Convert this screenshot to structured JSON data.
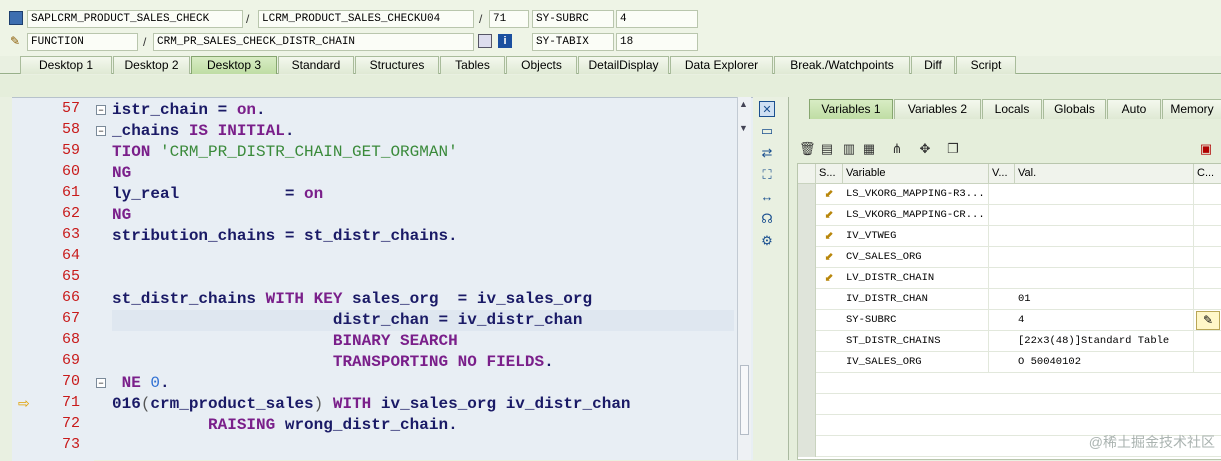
{
  "header": {
    "program": "SAPLCRM_PRODUCT_SALES_CHECK",
    "include": "LCRM_PRODUCT_SALES_CHECKU04",
    "line": "71",
    "subrc_label": "SY-SUBRC",
    "subrc_value": "4",
    "type": "FUNCTION",
    "event": "CRM_PR_SALES_CHECK_DISTR_CHAIN",
    "tabix_label": "SY-TABIX",
    "tabix_value": "18",
    "slash": "/"
  },
  "tabs": [
    "Desktop 1",
    "Desktop 2",
    "Desktop 3",
    "Standard",
    "Structures",
    "Tables",
    "Objects",
    "DetailDisplay",
    "Data Explorer",
    "Break./Watchpoints",
    "Diff",
    "Script"
  ],
  "active_tab": "Desktop 3",
  "code": {
    "line_numbers": [
      "57",
      "58",
      "59",
      "60",
      "61",
      "62",
      "63",
      "64",
      "65",
      "66",
      "67",
      "68",
      "69",
      "70",
      "71",
      "72",
      "73"
    ],
    "current_line": "71"
  },
  "right_tabs": [
    "Variables 1",
    "Variables 2",
    "Locals",
    "Globals",
    "Auto",
    "Memory"
  ],
  "grid": {
    "headers": [
      "S...",
      "Variable",
      "V...",
      "Val.",
      "C..."
    ],
    "rows": [
      {
        "variable": "LS_VKORG_MAPPING-R3...",
        "value": ""
      },
      {
        "variable": "LS_VKORG_MAPPING-CR...",
        "value": ""
      },
      {
        "variable": "IV_VTWEG",
        "value": ""
      },
      {
        "variable": "CV_SALES_ORG",
        "value": ""
      },
      {
        "variable": "LV_DISTR_CHAIN",
        "value": ""
      },
      {
        "variable": "IV_DISTR_CHAN",
        "value": "01"
      },
      {
        "variable": "SY-SUBRC",
        "value": "4"
      },
      {
        "variable": "ST_DISTR_CHAINS",
        "value": "[22x3(48)]Standard Table"
      },
      {
        "variable": "IV_SALES_ORG",
        "value": "O 50040102"
      }
    ]
  },
  "watermark": "@稀土掘金技术社区"
}
